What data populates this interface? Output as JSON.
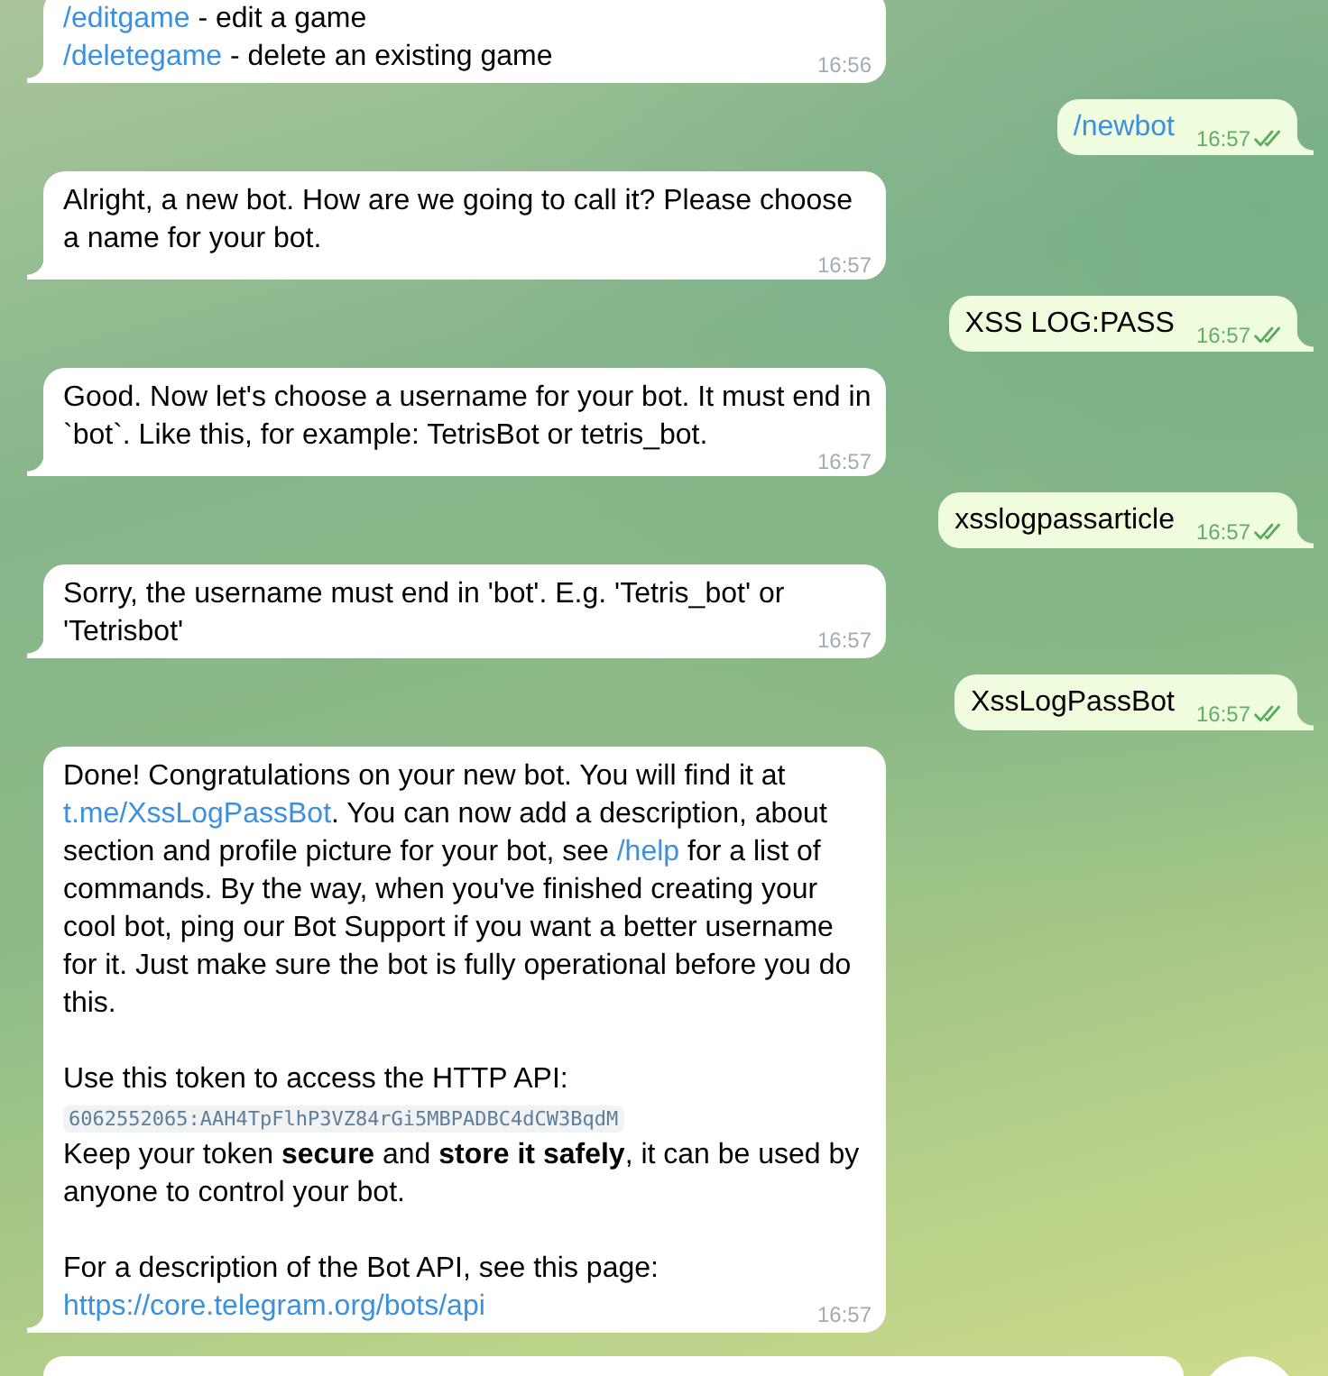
{
  "messages": [
    {
      "outgoing": false,
      "paragraphs": [
        [
          [
            {
              "kind": "link",
              "text": "/editgame"
            },
            {
              "kind": "text",
              "text": " - edit a game"
            }
          ],
          [
            {
              "kind": "link",
              "text": "/deletegame"
            },
            {
              "kind": "text",
              "text": " - delete an existing game"
            }
          ]
        ]
      ],
      "time": "16:56"
    },
    {
      "outgoing": true,
      "paragraphs": [
        [
          [
            {
              "kind": "link",
              "text": "/newbot"
            }
          ]
        ]
      ],
      "time": "16:57",
      "read": true
    },
    {
      "outgoing": false,
      "paragraphs": [
        [
          [
            {
              "kind": "text",
              "text": "Alright, a new bot. How are we going to call it? Please choose a name for your bot."
            }
          ]
        ]
      ],
      "time": "16:57"
    },
    {
      "outgoing": true,
      "paragraphs": [
        [
          [
            {
              "kind": "text",
              "text": "XSS LOG:PASS"
            }
          ]
        ]
      ],
      "time": "16:57",
      "read": true
    },
    {
      "outgoing": false,
      "paragraphs": [
        [
          [
            {
              "kind": "text",
              "text": "Good. Now let's choose a username for your bot. It must end in `bot`. Like this, for example: TetrisBot or tetris_bot."
            }
          ]
        ]
      ],
      "time": "16:57"
    },
    {
      "outgoing": true,
      "paragraphs": [
        [
          [
            {
              "kind": "text",
              "text": "xsslogpassarticle"
            }
          ]
        ]
      ],
      "time": "16:57",
      "read": true
    },
    {
      "outgoing": false,
      "paragraphs": [
        [
          [
            {
              "kind": "text",
              "text": "Sorry, the username must end in 'bot'. E.g. 'Tetris_bot' or 'Tetrisbot'"
            }
          ]
        ]
      ],
      "time": "16:57"
    },
    {
      "outgoing": true,
      "paragraphs": [
        [
          [
            {
              "kind": "text",
              "text": "XssLogPassBot"
            }
          ]
        ]
      ],
      "time": "16:57",
      "read": true
    },
    {
      "outgoing": false,
      "paragraphs": [
        [
          [
            {
              "kind": "text",
              "text": "Done! Congratulations on your new bot. You will find it at "
            },
            {
              "kind": "link",
              "text": "t.me/XssLogPassBot"
            },
            {
              "kind": "text",
              "text": ". You can now add a description, about section and profile picture for your bot, see "
            },
            {
              "kind": "link",
              "text": "/help"
            },
            {
              "kind": "text",
              "text": " for a list of commands. By the way, when you've finished creating your cool bot, ping our Bot Support if you want a better username for it. Just make sure the bot is fully operational before you do this."
            }
          ]
        ],
        [
          [
            {
              "kind": "text",
              "text": "Use this token to access the HTTP API:"
            }
          ],
          [
            {
              "kind": "code",
              "text": "6062552065:AAH4TpFlhP3VZ84rGi5MBPADBC4dCW3BqdM"
            }
          ],
          [
            {
              "kind": "text",
              "text": "Keep your token **secure** and **store it safely**, it can be used by anyone to control your bot."
            }
          ]
        ],
        [
          [
            {
              "kind": "text",
              "text": "For a description of the Bot API, see this page:"
            }
          ],
          [
            {
              "kind": "link",
              "text": "https://core.telegram.org/bots/api"
            }
          ]
        ]
      ],
      "time": "16:57"
    }
  ]
}
